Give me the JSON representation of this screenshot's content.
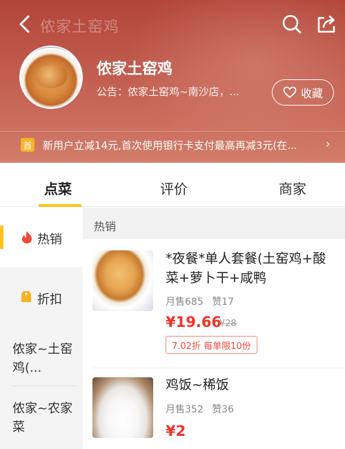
{
  "header": {
    "nav_title": "侬家土窑鸡",
    "shop_name": "侬家土窑鸡",
    "notice": "公告：侬家土窑鸡~南沙店，...",
    "favorite_label": "收藏",
    "promo_badge": "首",
    "promo_text": "新用户立减14元,首次使用银行卡支付最高再减3元(在...",
    "promo_arrow": "›"
  },
  "tabs": [
    {
      "label": "点菜"
    },
    {
      "label": "评价"
    },
    {
      "label": "商家"
    }
  ],
  "sidebar": {
    "items": [
      {
        "label": "热销",
        "icon": "flame-icon"
      },
      {
        "label": "折扣",
        "icon": "discount-tag-icon"
      },
      {
        "label": "侬家~土窑鸡(..."
      },
      {
        "label": "侬家~农家菜"
      }
    ]
  },
  "section": {
    "title": "热销"
  },
  "items": [
    {
      "title": "*夜餐*单人套餐(土窑鸡+酸菜+萝卜干+咸鸭",
      "sales": "月售685",
      "likes": "赞17",
      "price": "¥19.66",
      "old_price": "¥28",
      "discount": "7.02折 每单限10份"
    },
    {
      "title": "鸡饭~稀饭",
      "sales": "月售352",
      "likes": "赞36",
      "price": "¥2"
    }
  ],
  "colors": {
    "accent": "#ffc21e",
    "price": "#f0342a",
    "header": "#b2453a"
  }
}
